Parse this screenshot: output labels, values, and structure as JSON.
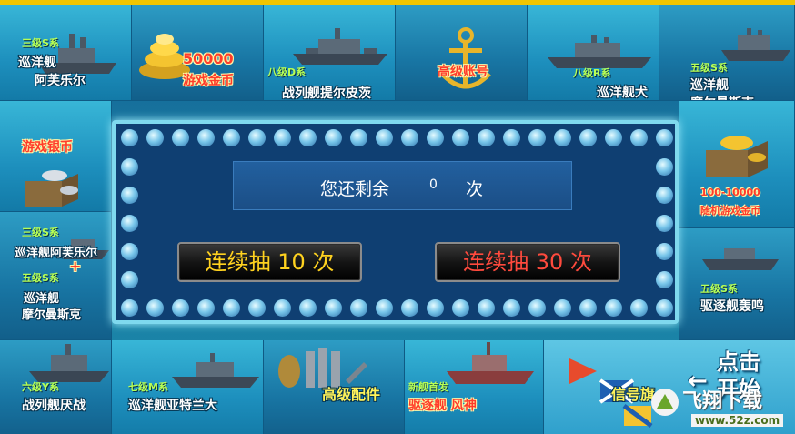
{
  "top_row": [
    {
      "tag": "三级S系",
      "name1": "巡洋舰",
      "name2": "阿芙乐尔"
    },
    {
      "amount": "50000",
      "label": "游戏金币"
    },
    {
      "tag": "八级D系",
      "name1": "战列舰提尔皮茨"
    },
    {
      "label": "高级账号"
    },
    {
      "tag": "八级R系",
      "name1": "巡洋舰犬"
    },
    {
      "tag": "五级S系",
      "name1": "巡洋舰",
      "name2": "摩尔曼斯克"
    }
  ],
  "left_col": [
    {
      "label": "游戏银币"
    },
    {
      "tag1": "三级S系",
      "name1": "巡洋舰阿芙乐尔",
      "plus": "+",
      "tag2": "五级S系",
      "name2": "巡洋舰",
      "name3": "摩尔曼斯克"
    }
  ],
  "right_col": [
    {
      "amount": "100-10000",
      "label": "随机游戏金币"
    },
    {
      "tag": "五级S系",
      "name1": "驱逐舰轰鸣"
    }
  ],
  "bottom_row": [
    {
      "tag": "六级Y系",
      "name1": "战列舰厌战"
    },
    {
      "tag": "七级M系",
      "name1": "巡洋舰亚特兰大"
    },
    {
      "label": "高级配件"
    },
    {
      "tag": "新舰首发",
      "name1": "驱逐舰 风神"
    },
    {
      "label": "信号旗"
    }
  ],
  "start": {
    "line1": "点击",
    "line2": "开始",
    "arrow": "←"
  },
  "counter": {
    "prefix": "您还剩余",
    "value": "0",
    "suffix": "次"
  },
  "buttons": {
    "draw10": "连续抽 10 次",
    "draw30": "连续抽 30 次"
  },
  "watermark": {
    "title": "飞翔下载",
    "url": "www.52z.com"
  },
  "colors": {
    "frame_top": "#f1c500",
    "tag": "#b7ff56",
    "gold": "#ffd21f",
    "red": "#ff4a3d"
  }
}
